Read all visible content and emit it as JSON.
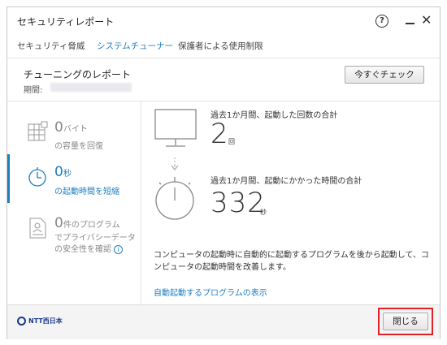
{
  "window": {
    "title": "セキュリティレポート"
  },
  "tabs": [
    {
      "label": "セキュリティ脅威"
    },
    {
      "label": "システムチューナー"
    },
    {
      "label": "保護者による使用制限"
    }
  ],
  "report": {
    "title": "チューニングのレポート",
    "period_label": "期間:",
    "check_button": "今すぐチェック"
  },
  "nav": [
    {
      "value": "0",
      "value_unit": "バイト",
      "label": "の容量を回復"
    },
    {
      "value": "0",
      "value_unit": "秒",
      "label": "の起動時間を短縮"
    },
    {
      "value": "0",
      "value_unit": "件のプログラム",
      "label": "でプライバシーデータ",
      "label2": "の安全性を確認"
    }
  ],
  "stats": {
    "boot_count_head": "過去1か月間、起動した回数の合計",
    "boot_count": "2",
    "boot_count_unit": "回",
    "boot_time_head": "過去1か月間、起動にかかった時間の合計",
    "boot_time": "332",
    "boot_time_unit": "秒"
  },
  "description": "コンピュータの起動時に自動的に起動するプログラムを後から起動して、コンピュータの起動時間を改善します。",
  "link": "自動起動するプログラムの表示",
  "footer": {
    "logo": "NTT西日本",
    "close_button": "閉じる"
  },
  "colors": {
    "accent": "#1d7ec0",
    "highlight": "#e0202a"
  }
}
